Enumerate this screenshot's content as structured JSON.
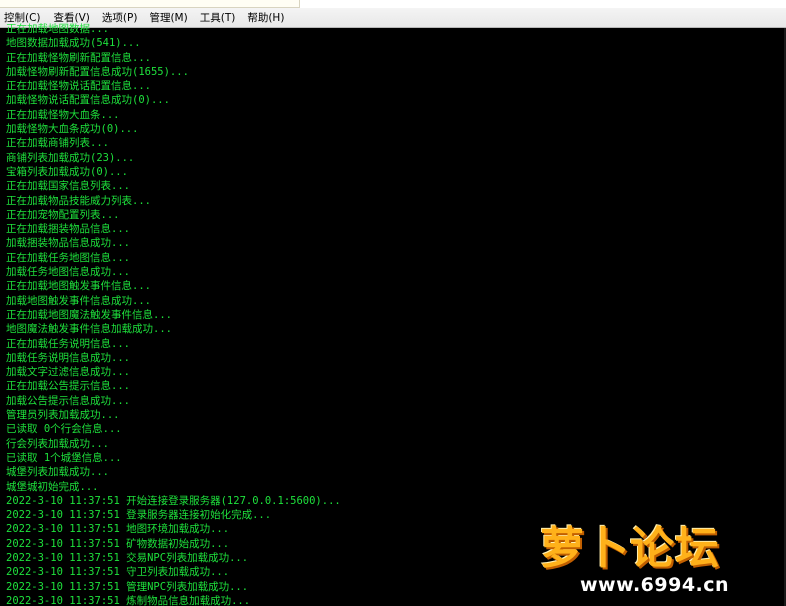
{
  "menu": {
    "items": [
      {
        "label": "控制(C)"
      },
      {
        "label": "查看(V)"
      },
      {
        "label": "选项(P)"
      },
      {
        "label": "管理(M)"
      },
      {
        "label": "工具(T)"
      },
      {
        "label": "帮助(H)"
      }
    ]
  },
  "console": {
    "lines": [
      "正在加载地图数据...",
      "地图数据加载成功(541)...",
      "正在加载怪物刷新配置信息...",
      "加载怪物刷新配置信息成功(1655)...",
      "正在加载怪物说话配置信息...",
      "加载怪物说话配置信息成功(0)...",
      "正在加载怪物大血条...",
      "加载怪物大血条成功(0)...",
      "正在加载商铺列表...",
      "商铺列表加载成功(23)...",
      "宝箱列表加载成功(0)...",
      "正在加载国家信息列表...",
      "正在加载物品技能威力列表...",
      "正在加宠物配置列表...",
      "正在加载捆装物品信息...",
      "加载捆装物品信息成功...",
      "正在加载任务地图信息...",
      "加载任务地图信息成功...",
      "正在加载地图触发事件信息...",
      "加载地图触发事件信息成功...",
      "正在加载地图魔法触发事件信息...",
      "地图魔法触发事件信息加载成功...",
      "正在加载任务说明信息...",
      "加载任务说明信息成功...",
      "加载文字过滤信息成功...",
      "正在加载公告提示信息...",
      "加载公告提示信息成功...",
      "管理员列表加载成功...",
      "已读取 0个行会信息...",
      "行会列表加载成功...",
      "已读取 1个城堡信息...",
      "城堡列表加载成功...",
      "城堡城初始完成...",
      "2022-3-10 11:37:51 开始连接登录服务器(127.0.0.1:5600)...",
      "2022-3-10 11:37:51 登录服务器连接初始化完成...",
      "2022-3-10 11:37:51 地图环境加载成功...",
      "2022-3-10 11:37:51 矿物数据初始成功...",
      "2022-3-10 11:37:51 交易NPC列表加载成功...",
      "2022-3-10 11:37:51 守卫列表加载成功...",
      "2022-3-10 11:37:51 管理NPC列表加载成功...",
      "2022-3-10 11:37:51 炼制物品信息加载成功..."
    ]
  },
  "watermark": {
    "title": "萝卜论坛",
    "url": "www.6994.cn"
  },
  "colors": {
    "console_text": "#1ee13c",
    "console_bg": "#000000",
    "menubar_bg": "#f0f0f0",
    "watermark_orange": "#ffb11a"
  }
}
